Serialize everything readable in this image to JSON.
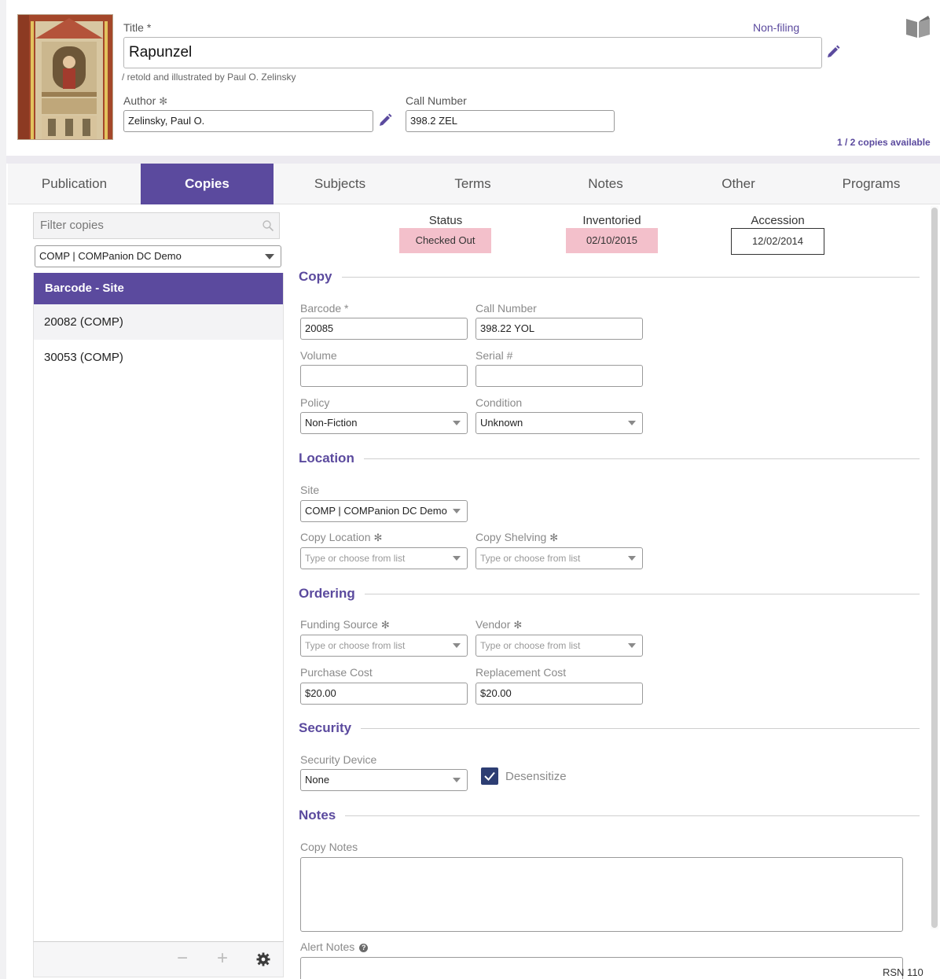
{
  "header": {
    "title_label": "Title *",
    "title_value": "Rapunzel",
    "subtitle": "/ retold and illustrated by Paul O. Zelinsky",
    "non_filing_label": "Non-filing",
    "author_label": "Author",
    "author_value": "Zelinsky, Paul O.",
    "call_number_label": "Call Number",
    "call_number_value": "398.2 ZEL",
    "copies_available": "1 / 2 copies available",
    "required_mark": "✻"
  },
  "tabs": [
    {
      "label": "Publication"
    },
    {
      "label": "Copies"
    },
    {
      "label": "Subjects"
    },
    {
      "label": "Terms"
    },
    {
      "label": "Notes"
    },
    {
      "label": "Other"
    },
    {
      "label": "Programs"
    }
  ],
  "active_tab": "Copies",
  "left": {
    "filter_placeholder": "Filter copies",
    "site_select": "COMP | COMPanion DC Demo",
    "list_header": "Barcode - Site",
    "items": [
      "20082 (COMP)",
      "30053 (COMP)"
    ],
    "minus": "−",
    "plus": "+"
  },
  "status": {
    "status_label": "Status",
    "status_value": "Checked Out",
    "inventoried_label": "Inventoried",
    "inventoried_value": "02/10/2015",
    "accession_label": "Accession",
    "accession_value": "12/02/2014"
  },
  "copy": {
    "section": "Copy",
    "barcode_label": "Barcode *",
    "barcode_value": "20085",
    "call_number_label": "Call Number",
    "call_number_value": "398.22 YOL",
    "volume_label": "Volume",
    "volume_value": "",
    "serial_label": "Serial #",
    "serial_value": "",
    "policy_label": "Policy",
    "policy_value": "Non-Fiction",
    "condition_label": "Condition",
    "condition_value": "Unknown"
  },
  "location": {
    "section": "Location",
    "site_label": "Site",
    "site_value": "COMP | COMPanion DC Demo",
    "copy_location_label": "Copy Location",
    "copy_location_placeholder": "Type or choose from list",
    "copy_shelving_label": "Copy Shelving",
    "copy_shelving_placeholder": "Type or choose from list"
  },
  "ordering": {
    "section": "Ordering",
    "funding_label": "Funding Source",
    "funding_placeholder": "Type or choose from list",
    "vendor_label": "Vendor",
    "vendor_placeholder": "Type or choose from list",
    "purchase_label": "Purchase Cost",
    "purchase_value": "$20.00",
    "replacement_label": "Replacement Cost",
    "replacement_value": "$20.00"
  },
  "security": {
    "section": "Security",
    "device_label": "Security Device",
    "device_value": "None",
    "desensitize_label": "Desensitize",
    "desensitize_checked": true
  },
  "notes": {
    "section": "Notes",
    "copy_notes_label": "Copy Notes",
    "alert_notes_label": "Alert Notes",
    "help_glyph": "?"
  },
  "rsn": "RSN 110",
  "colors": {
    "accent": "#5b4a9e",
    "status_badge": "#f3c0cb",
    "checkbox": "#2d3e73"
  }
}
